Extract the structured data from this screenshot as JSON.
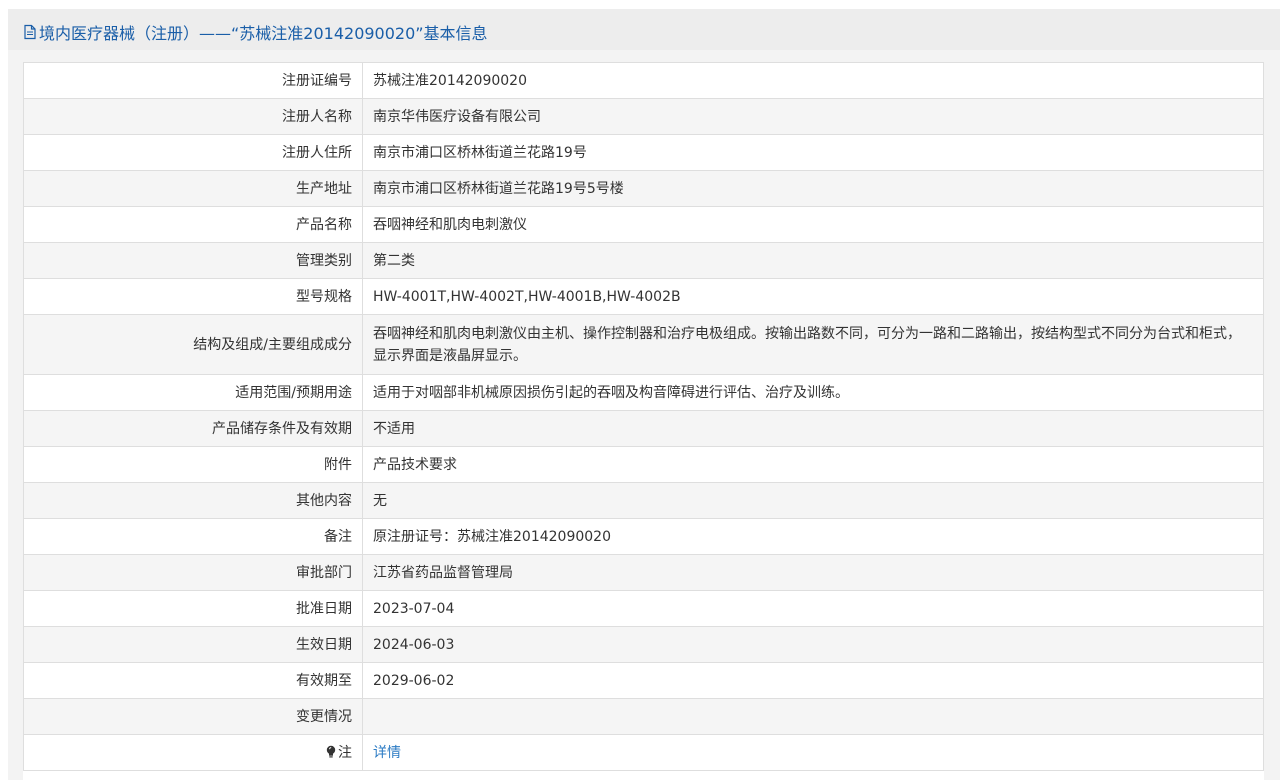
{
  "header": {
    "title": "境内医疗器械（注册）——“苏械注准20142090020”基本信息",
    "icon": "document-icon"
  },
  "rows": [
    {
      "label": "注册证编号",
      "value": "苏械注准20142090020"
    },
    {
      "label": "注册人名称",
      "value": "南京华伟医疗设备有限公司"
    },
    {
      "label": "注册人住所",
      "value": "南京市浦口区桥林街道兰花路19号"
    },
    {
      "label": "生产地址",
      "value": "南京市浦口区桥林街道兰花路19号5号楼"
    },
    {
      "label": "产品名称",
      "value": "吞咽神经和肌肉电刺激仪"
    },
    {
      "label": "管理类别",
      "value": "第二类"
    },
    {
      "label": "型号规格",
      "value": "HW-4001T,HW-4002T,HW-4001B,HW-4002B"
    },
    {
      "label": "结构及组成/主要组成成分",
      "value": "吞咽神经和肌肉电刺激仪由主机、操作控制器和治疗电极组成。按输出路数不同，可分为一路和二路输出，按结构型式不同分为台式和柜式，显示界面是液晶屏显示。"
    },
    {
      "label": "适用范围/预期用途",
      "value": "适用于对咽部非机械原因损伤引起的吞咽及构音障碍进行评估、治疗及训练。"
    },
    {
      "label": "产品储存条件及有效期",
      "value": "不适用"
    },
    {
      "label": "附件",
      "value": "产品技术要求"
    },
    {
      "label": "其他内容",
      "value": "无"
    },
    {
      "label": "备注",
      "value": "原注册证号：苏械注准20142090020"
    },
    {
      "label": "审批部门",
      "value": "江苏省药品监督管理局"
    },
    {
      "label": "批准日期",
      "value": "2023-07-04"
    },
    {
      "label": "生效日期",
      "value": "2024-06-03"
    },
    {
      "label": "有效期至",
      "value": "2029-06-02"
    },
    {
      "label": "变更情况",
      "value": ""
    }
  ],
  "note": {
    "label": "注",
    "icon": "lightbulb-icon",
    "link_text": "详情"
  },
  "colors": {
    "title": "#1a5ea8",
    "link": "#2b7bc4",
    "alt_row": "#f5f5f5",
    "border": "#dedede"
  }
}
